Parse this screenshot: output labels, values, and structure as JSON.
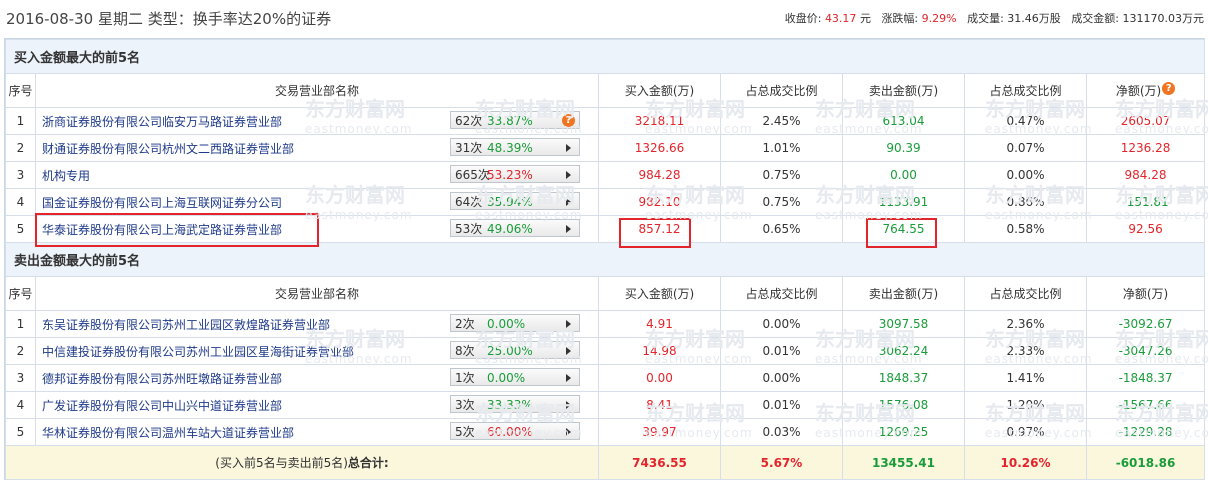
{
  "header": {
    "date": "2016-08-30",
    "weekday": "星期二",
    "type_label": "类型：换手率达20%的证券",
    "close_label": "收盘价:",
    "close_value": "43.17",
    "close_unit": "元",
    "change_label": "涨跌幅:",
    "change_value": "9.29%",
    "volume_text": "成交量: 31.46万股",
    "amount_text": "成交金额: 131170.03万元"
  },
  "columns": [
    "序号",
    "交易营业部名称",
    "买入金额(万)",
    "占总成交比例",
    "卖出金额(万)",
    "占总成交比例",
    "净额(万)"
  ],
  "buy_section": {
    "title": "买入金额最大的前5名",
    "rows": [
      {
        "rank": "1",
        "name": "浙商证券股份有限公司临安万马路证券营业部",
        "times": "62次",
        "rate": "33.87%",
        "rate_color": "green",
        "icon": "question",
        "buy": "3218.11",
        "buy_pct": "2.45%",
        "sell": "613.04",
        "sell_pct": "0.47%",
        "net": "2605.07"
      },
      {
        "rank": "2",
        "name": "财通证券股份有限公司杭州文二西路证券营业部",
        "times": "31次",
        "rate": "48.39%",
        "rate_color": "green",
        "icon": "arrow",
        "buy": "1326.66",
        "buy_pct": "1.01%",
        "sell": "90.39",
        "sell_pct": "0.07%",
        "net": "1236.28"
      },
      {
        "rank": "3",
        "name": "机构专用",
        "times": "665次",
        "rate": "53.23%",
        "rate_color": "red",
        "icon": "arrow",
        "buy": "984.28",
        "buy_pct": "0.75%",
        "sell": "0.00",
        "sell_pct": "0.00%",
        "net": "984.28"
      },
      {
        "rank": "4",
        "name": "国金证券股份有限公司上海互联网证券分公司",
        "times": "64次",
        "rate": "35.94%",
        "rate_color": "green",
        "icon": "arrow",
        "buy": "982.10",
        "buy_pct": "0.75%",
        "sell": "1133.91",
        "sell_pct": "0.86%",
        "net": "-151.81"
      },
      {
        "rank": "5",
        "name": "华泰证券股份有限公司上海武定路证券营业部",
        "times": "53次",
        "rate": "49.06%",
        "rate_color": "green",
        "icon": "arrow",
        "buy": "857.12",
        "buy_pct": "0.65%",
        "sell": "764.55",
        "sell_pct": "0.58%",
        "net": "92.56"
      }
    ]
  },
  "sell_section": {
    "title": "卖出金额最大的前5名",
    "rows": [
      {
        "rank": "1",
        "name": "东吴证券股份有限公司苏州工业园区敦煌路证券营业部",
        "times": "2次",
        "rate": "0.00%",
        "rate_color": "green",
        "icon": "arrow",
        "buy": "4.91",
        "buy_pct": "0.00%",
        "sell": "3097.58",
        "sell_pct": "2.36%",
        "net": "-3092.67"
      },
      {
        "rank": "2",
        "name": "中信建投证券股份有限公司苏州工业园区星海街证券营业部",
        "times": "8次",
        "rate": "25.00%",
        "rate_color": "green",
        "icon": "arrow",
        "buy": "14.98",
        "buy_pct": "0.01%",
        "sell": "3062.24",
        "sell_pct": "2.33%",
        "net": "-3047.26"
      },
      {
        "rank": "3",
        "name": "德邦证券股份有限公司苏州旺墩路证券营业部",
        "times": "1次",
        "rate": "0.00%",
        "rate_color": "green",
        "icon": "arrow",
        "buy": "0.00",
        "buy_pct": "0.00%",
        "sell": "1848.37",
        "sell_pct": "1.41%",
        "net": "-1848.37"
      },
      {
        "rank": "4",
        "name": "广发证券股份有限公司中山兴中道证券营业部",
        "times": "3次",
        "rate": "33.33%",
        "rate_color": "green",
        "icon": "arrow",
        "buy": "8.41",
        "buy_pct": "0.01%",
        "sell": "1576.08",
        "sell_pct": "1.20%",
        "net": "-1567.66"
      },
      {
        "rank": "5",
        "name": "华林证券股份有限公司温州车站大道证券营业部",
        "times": "5次",
        "rate": "60.00%",
        "rate_color": "red",
        "icon": "arrow",
        "buy": "39.97",
        "buy_pct": "0.03%",
        "sell": "1269.25",
        "sell_pct": "0.97%",
        "net": "-1229.28"
      }
    ]
  },
  "total": {
    "label_prefix": "(买入前5名与卖出前5名)",
    "label_bold": "总合计:",
    "buy": "7436.55",
    "buy_pct": "5.67%",
    "sell": "13455.41",
    "sell_pct": "10.26%",
    "net": "-6018.86"
  },
  "watermark": {
    "cn": "东方财富网",
    "en": "eastmoney.com"
  },
  "colors": {
    "red": "#e3242b",
    "green": "#1a9c3a",
    "section_bg": "#edf3fa",
    "total_bg": "#fbf7dd",
    "highlight": "#e3242b"
  }
}
